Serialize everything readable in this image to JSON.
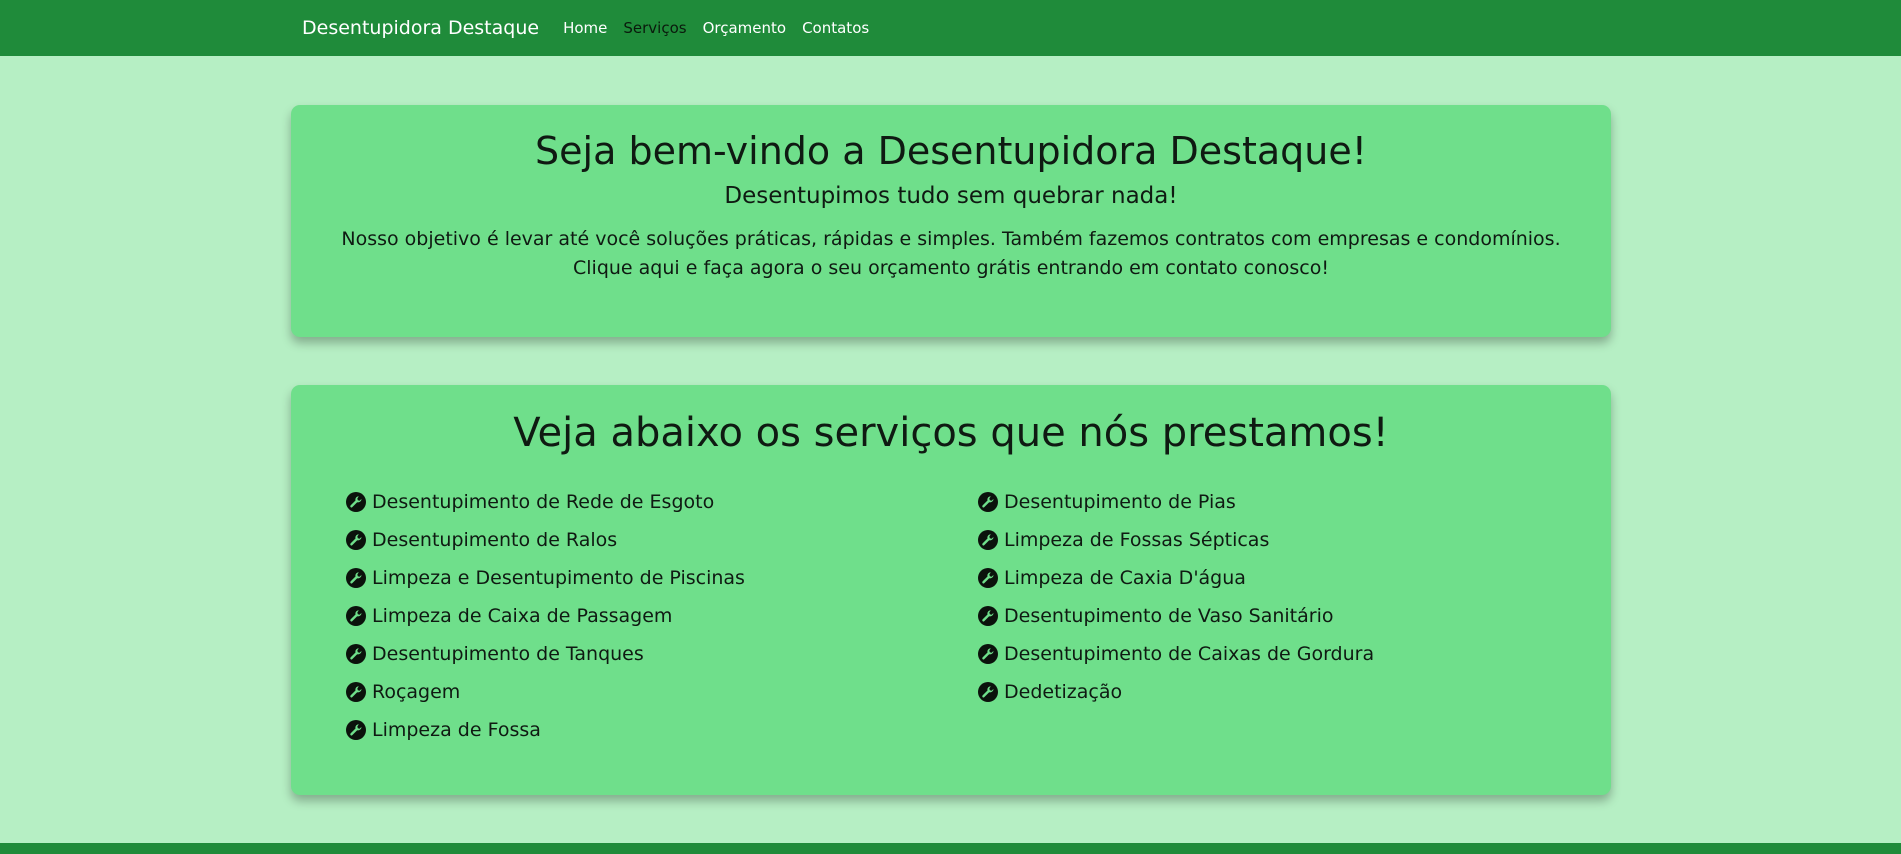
{
  "navbar": {
    "brand": "Desentupidora Destaque",
    "links": [
      {
        "label": "Home",
        "active": false
      },
      {
        "label": "Serviços",
        "active": true
      },
      {
        "label": "Orçamento",
        "active": false
      },
      {
        "label": "Contatos",
        "active": false
      }
    ]
  },
  "hero": {
    "title": "Seja bem-vindo a Desentupidora Destaque!",
    "subtitle": "Desentupimos tudo sem quebrar nada!",
    "text": "Nosso objetivo é levar até você soluções práticas, rápidas e simples. Também fazemos contratos com empresas e condomínios. Clique aqui e faça agora o seu orçamento grátis entrando em contato conosco!"
  },
  "services": {
    "title": "Veja abaixo os serviços que nós prestamos!",
    "icon": "wrench-icon",
    "left": [
      "Desentupimento de Rede de Esgoto",
      "Desentupimento de Ralos",
      "Limpeza e Desentupimento de Piscinas",
      "Limpeza de Caixa de Passagem",
      "Desentupimento de Tanques",
      "Roçagem",
      "Limpeza de Fossa"
    ],
    "right": [
      "Desentupimento de Pias",
      "Limpeza de Fossas Sépticas",
      "Limpeza de Caxia D'água",
      "Desentupimento de Vaso Sanitário",
      "Desentupimento de Caixas de Gordura",
      "Dedetização"
    ]
  },
  "colors": {
    "navbar": "#1f8b3a",
    "background": "#b6efc4",
    "card": "#6fdf8b"
  }
}
